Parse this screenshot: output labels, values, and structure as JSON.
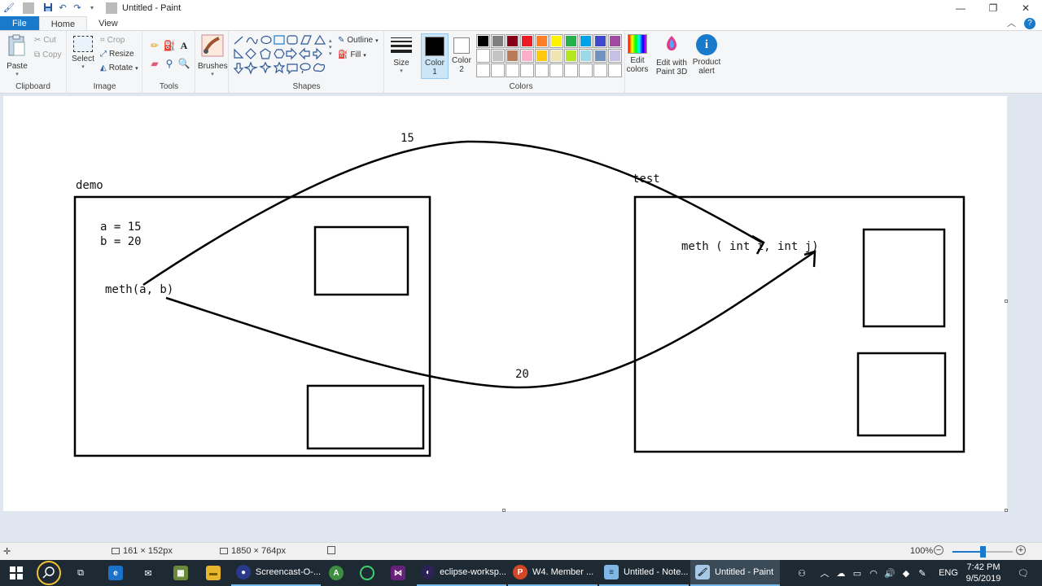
{
  "window": {
    "title": "Untitled - Paint",
    "minimize_glyph": "—",
    "restore_glyph": "❐",
    "close_glyph": "✕"
  },
  "tabs": [
    {
      "label": "File"
    },
    {
      "label": "Home"
    },
    {
      "label": "View"
    }
  ],
  "ribbon": {
    "clipboard": {
      "label": "Clipboard",
      "paste": "Paste",
      "cut": "Cut",
      "copy": "Copy"
    },
    "image": {
      "label": "Image",
      "select": "Select",
      "crop": "Crop",
      "resize": "Resize",
      "rotate": "Rotate"
    },
    "tools": {
      "label": "Tools"
    },
    "brushes": {
      "label": "Brushes"
    },
    "shapes": {
      "label": "Shapes",
      "outline": "Outline",
      "fill": "Fill"
    },
    "size": {
      "label": "Size"
    },
    "color1": {
      "label": "Color 1",
      "value": "#000000"
    },
    "color2": {
      "label": "Color 2",
      "value": "#ffffff"
    },
    "colors": {
      "label": "Colors",
      "row1": [
        "#000000",
        "#7f7f7f",
        "#880015",
        "#ed1c24",
        "#ff7f27",
        "#fff200",
        "#22b14c",
        "#00a2e8",
        "#3f48cc",
        "#a349a4"
      ],
      "row2": [
        "#ffffff",
        "#c3c3c3",
        "#b97a57",
        "#ffaec9",
        "#ffc90e",
        "#efe4b0",
        "#b5e61d",
        "#99d9ea",
        "#7092be",
        "#c8bfe7"
      ],
      "row3": [
        "#ffffff",
        "#ffffff",
        "#ffffff",
        "#ffffff",
        "#ffffff",
        "#ffffff",
        "#ffffff",
        "#ffffff",
        "#ffffff",
        "#ffffff"
      ]
    },
    "edit_colors": "Edit colors",
    "paint3d": "Edit with Paint 3D",
    "product_alert": "Product alert"
  },
  "canvas": {
    "labels": {
      "demo": "demo",
      "test": "test",
      "a_assign": "a = 15",
      "b_assign": "b = 20",
      "call": "meth(a, b)",
      "signature": "meth ( int i, int j)",
      "arrow15": "15",
      "arrow20": "20"
    }
  },
  "status": {
    "selection_size": "161 × 152px",
    "canvas_size": "1850 × 764px",
    "zoom": "100%",
    "zoom_fraction": 0.5
  },
  "taskbar": {
    "apps": [
      {
        "label": "Screencast-O-..."
      },
      {
        "label": "eclipse-worksp..."
      },
      {
        "label": "W4. Member ..."
      },
      {
        "label": "Untitled - Note..."
      },
      {
        "label": "Untitled - Paint"
      }
    ],
    "lang": "ENG",
    "time": "7:42 PM",
    "date": "9/5/2019"
  }
}
